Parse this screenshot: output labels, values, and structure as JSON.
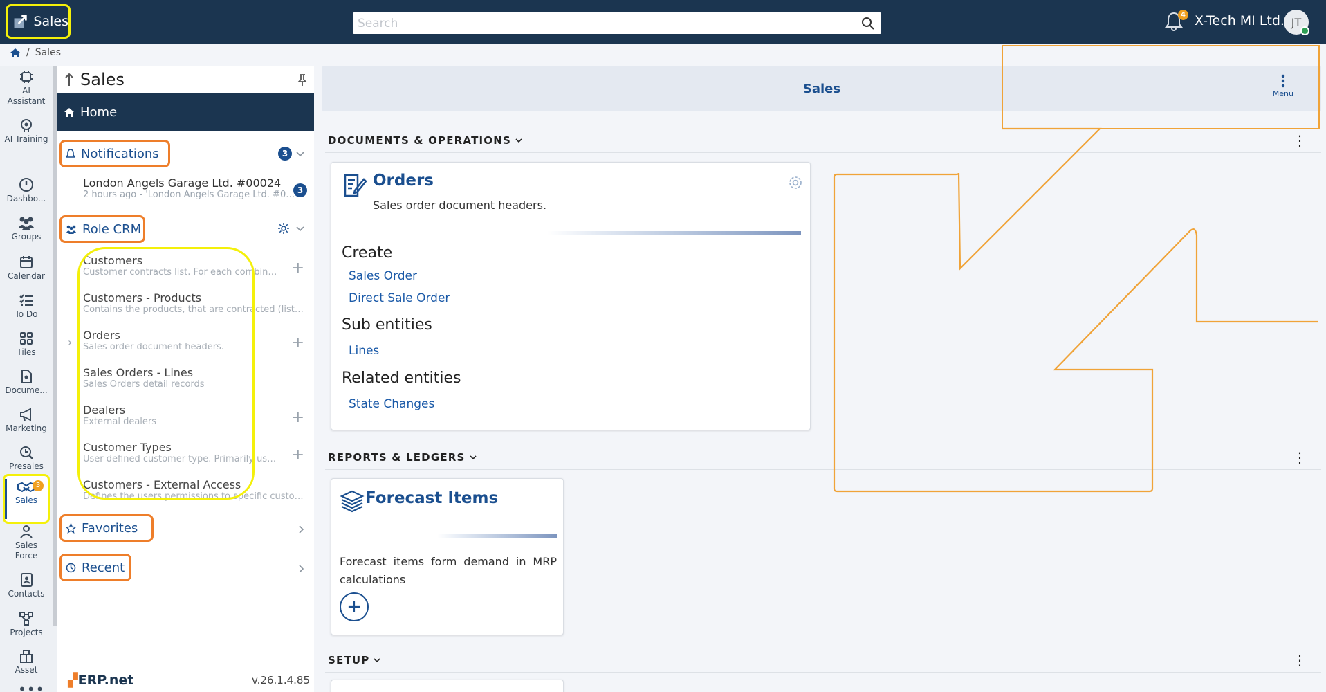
{
  "app": {
    "title": "Sales"
  },
  "search": {
    "placeholder": "Search"
  },
  "header": {
    "notification_count": "4",
    "company": "X-Tech MI Ltd.",
    "user_initials": "JT"
  },
  "breadcrumb": {
    "items": [
      "Sales"
    ]
  },
  "rail": {
    "items": [
      {
        "label": "AI Assistant",
        "icon": "ai-chip-icon"
      },
      {
        "label": "AI Training",
        "icon": "ai-training-icon"
      },
      {
        "label": "Dashbo...",
        "icon": "dashboard-icon"
      },
      {
        "label": "Groups",
        "icon": "groups-icon"
      },
      {
        "label": "Calendar",
        "icon": "calendar-icon"
      },
      {
        "label": "To Do",
        "icon": "todo-icon"
      },
      {
        "label": "Tiles",
        "icon": "tiles-icon"
      },
      {
        "label": "Docume...",
        "icon": "document-icon"
      },
      {
        "label": "Marketing",
        "icon": "megaphone-icon"
      },
      {
        "label": "Presales",
        "icon": "presales-icon"
      },
      {
        "label": "Sales",
        "icon": "handshake-icon",
        "badge": "3"
      },
      {
        "label": "Sales Force",
        "icon": "sales-force-icon"
      },
      {
        "label": "Contacts",
        "icon": "contacts-icon"
      },
      {
        "label": "Projects",
        "icon": "projects-icon"
      },
      {
        "label": "Asset",
        "icon": "asset-icon"
      }
    ],
    "more": "•••"
  },
  "nav": {
    "title": "Sales",
    "home": "Home",
    "notifications": {
      "label": "Notifications",
      "count": "3",
      "item_title": "London Angels Garage Ltd. #00024",
      "item_sub": "2 hours ago - 'London Angels Garage Ltd. #000...",
      "item_count": "3"
    },
    "role": {
      "label": "Role CRM",
      "items": [
        {
          "title": "Customers",
          "desc": "Customer contracts list. For each combinati...",
          "plus": true
        },
        {
          "title": "Customers - Products",
          "desc": "Contains the products, that are contracted (listed)...",
          "plus": false
        },
        {
          "title": "Orders",
          "desc": "Sales order document headers.",
          "plus": true
        },
        {
          "title": "Sales Orders - Lines",
          "desc": "Sales Orders detail records",
          "plus": false
        },
        {
          "title": "Dealers",
          "desc": "External dealers",
          "plus": true
        },
        {
          "title": "Customer Types",
          "desc": "User defined customer type. Primarily used ...",
          "plus": true
        },
        {
          "title": "Customers - External Access",
          "desc": "Defines the users permissions to specific custome...",
          "plus": false
        }
      ]
    },
    "favorites": "Favorites",
    "recent": "Recent",
    "logo": "ERP.net",
    "version": "v.26.1.4.85"
  },
  "main": {
    "header_title": "Sales",
    "menu_label": "Menu",
    "groups": {
      "docs": "DOCUMENTS & OPERATIONS",
      "reports": "REPORTS & LEDGERS",
      "setup": "SETUP"
    },
    "orders_card": {
      "title": "Orders",
      "subtitle": "Sales order document headers.",
      "create_label": "Create",
      "create_links": [
        "Sales Order",
        "Direct Sale Order"
      ],
      "sub_label": "Sub entities",
      "sub_links": [
        "Lines"
      ],
      "related_label": "Related entities",
      "related_links": [
        "State Changes"
      ]
    },
    "forecast_card": {
      "title": "Forecast Items",
      "text": "Forecast items form demand in MRP calculations",
      "add": "+"
    }
  },
  "colors": {
    "topbar": "#1b3550",
    "accent": "#1b4f8f",
    "highlight_yellow": "#f4f00a",
    "highlight_orange": "#ee7e2a",
    "badge": "#f0a020"
  }
}
